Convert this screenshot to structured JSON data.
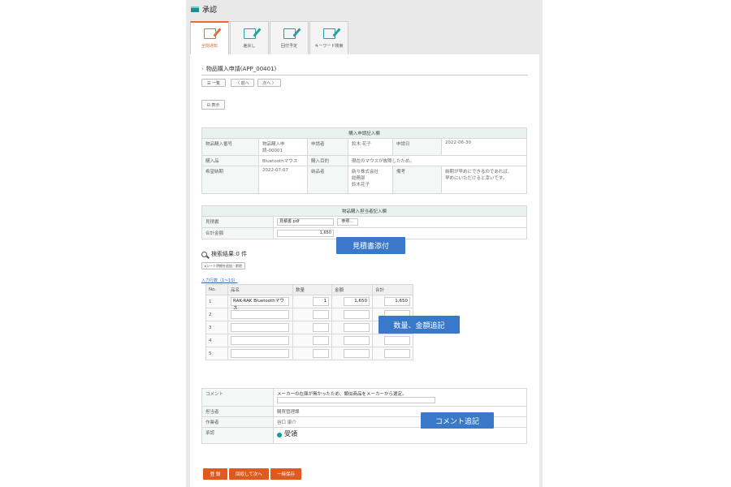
{
  "window": {
    "title": "承認"
  },
  "tabs": [
    {
      "label": "全閲通知"
    },
    {
      "label": "差戻し"
    },
    {
      "label": "回付予定"
    },
    {
      "label": "キーワード検索"
    }
  ],
  "heading": {
    "text": "物品購入申請(APP_00401)"
  },
  "nav": {
    "list": "☰ 一覧",
    "prev": "〈 前へ",
    "next": "次へ 〉",
    "print": "⊟ 表示"
  },
  "applicant_table": {
    "title": "購入申請記入欄",
    "rows": [
      {
        "l1": "物品購入番号",
        "v1": "物品購入申請-00001",
        "l2": "申請者",
        "v2": "鈴木 花子",
        "l3": "申請日",
        "v3": "2022-06-30"
      },
      {
        "l1": "購入品",
        "v1": "Bluetoothマウス",
        "l2": "購入目的",
        "v2": "現在のマウスが故障したため。"
      },
      {
        "l1": "希望納期",
        "v1": "2022-07-07",
        "l2": "納品者",
        "v2a": "新々株式会社",
        "v2b": "総務部",
        "v2c": "鈴木花子",
        "l3": "備考",
        "v3a": "納期が早めにできるのであれば、",
        "v3b": "早めにいただけると幸いです。"
      }
    ]
  },
  "purchase_table": {
    "title": "物品購入担当者記入欄",
    "quote_label": "見積書",
    "quote_file": "見積書.pdf",
    "browse": "参照...",
    "total_label": "合計金額",
    "total_value": "1,650"
  },
  "callouts": {
    "quote": "見積書添付",
    "qty": "数量、金額追記",
    "comment": "コメント追記"
  },
  "search": {
    "result": "検索結果:0 件",
    "clear": "▸シート明細を追加・削除",
    "range": "入力行数（1〜10）"
  },
  "items_table": {
    "headers": [
      "No.",
      "品名",
      "数量",
      "金額",
      "合計"
    ],
    "rows": [
      {
        "no": "1",
        "name": "RAK-RAK Bluetoothマウス",
        "qty": "1",
        "price": "1,650",
        "total": "1,650"
      },
      {
        "no": "2",
        "name": "",
        "qty": "",
        "price": "",
        "total": ""
      },
      {
        "no": "3",
        "name": "",
        "qty": "",
        "price": "",
        "total": ""
      },
      {
        "no": "4",
        "name": "",
        "qty": "",
        "price": "",
        "total": ""
      },
      {
        "no": "5",
        "name": "",
        "qty": "",
        "price": "",
        "total": ""
      }
    ]
  },
  "approval": {
    "comment_label": "コメント",
    "comment_value": "メーカーの在庫が無かったため、類似商品をメーカーから選定。",
    "handler_label": "担当者",
    "handler_value": "購買管理課",
    "worker_label": "作業者",
    "worker_value": "谷口 康介",
    "decision_label": "承認",
    "decision_value": "受領"
  },
  "buttons": {
    "register": "登 録",
    "save_next": "回収して次へ",
    "temp_save": "一時保存"
  },
  "colors": {
    "accent": "#e05a20",
    "teal": "#1f8f8f",
    "callout": "#3a78c9"
  }
}
